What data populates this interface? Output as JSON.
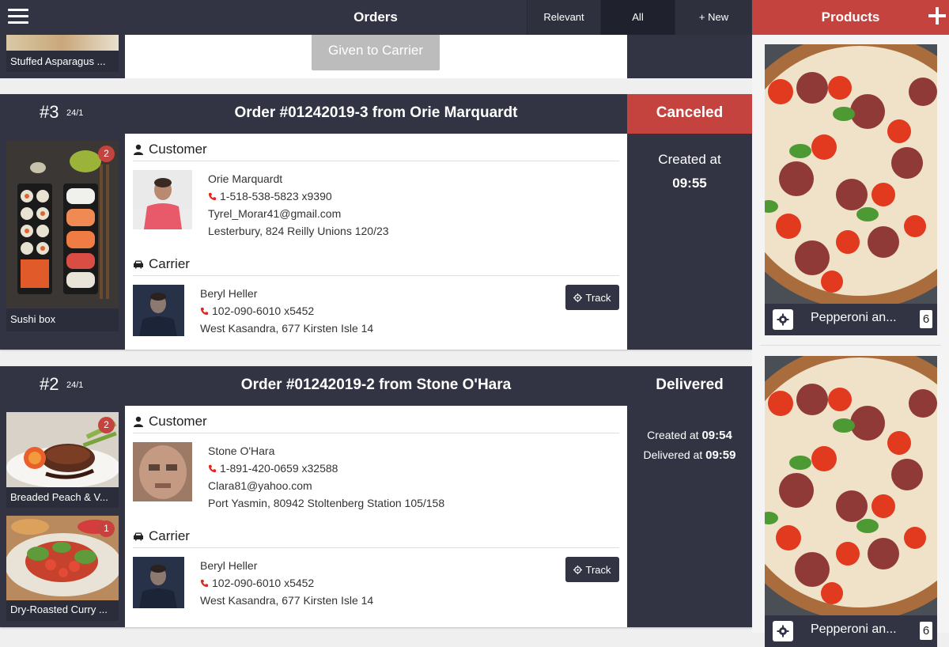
{
  "header": {
    "title": "Orders",
    "filters": {
      "relevant": "Relevant",
      "all": "All",
      "new_order": "+ New Order"
    }
  },
  "prev_order": {
    "item_label": "Stuffed Asparagus ...",
    "action_label": "Given to Carrier"
  },
  "orders": [
    {
      "number": "#3",
      "date": "24/1",
      "title": "Order #01242019-3 from Orie Marquardt",
      "status": "Canceled",
      "status_color": "#c5433f",
      "items": [
        {
          "label": "Sushi box",
          "qty": "2"
        }
      ],
      "customer_heading": "Customer",
      "customer": {
        "name": "Orie Marquardt",
        "phone": "1-518-538-5823 x9390",
        "email": "Tyrel_Morar41@gmail.com",
        "address": "Lesterbury, 824 Reilly Unions 120/23"
      },
      "carrier_heading": "Carrier",
      "carrier": {
        "name": "Beryl Heller",
        "phone": "102-090-6010 x5452",
        "address": "West Kasandra, 677 Kirsten Isle 14"
      },
      "track_label": "Track",
      "created_label": "Created at",
      "created_time": "09:55"
    },
    {
      "number": "#2",
      "date": "24/1",
      "title": "Order #01242019-2 from Stone O'Hara",
      "status": "Delivered",
      "status_color": "#323443",
      "items": [
        {
          "label": "Breaded Peach & V...",
          "qty": "2"
        },
        {
          "label": "Dry-Roasted Curry ...",
          "qty": "1"
        }
      ],
      "customer_heading": "Customer",
      "customer": {
        "name": "Stone O'Hara",
        "phone": "1-891-420-0659 x32588",
        "email": "Clara81@yahoo.com",
        "address": "Port Yasmin, 80942 Stoltenberg Station 105/158"
      },
      "carrier_heading": "Carrier",
      "carrier": {
        "name": "Beryl Heller",
        "phone": "102-090-6010 x5452",
        "address": "West Kasandra, 677 Kirsten Isle 14"
      },
      "track_label": "Track",
      "created_label": "Created at",
      "created_time": "09:54",
      "delivered_label": "Delivered at",
      "delivered_time": "09:59"
    }
  ],
  "products": {
    "title": "Products",
    "items": [
      {
        "name": "Pepperoni an...",
        "count": "6"
      },
      {
        "name": "Pepperoni an...",
        "count": "6"
      }
    ]
  },
  "colors": {
    "dark": "#323443",
    "accent": "#c5433f",
    "phone_icon": "#e0261f"
  }
}
